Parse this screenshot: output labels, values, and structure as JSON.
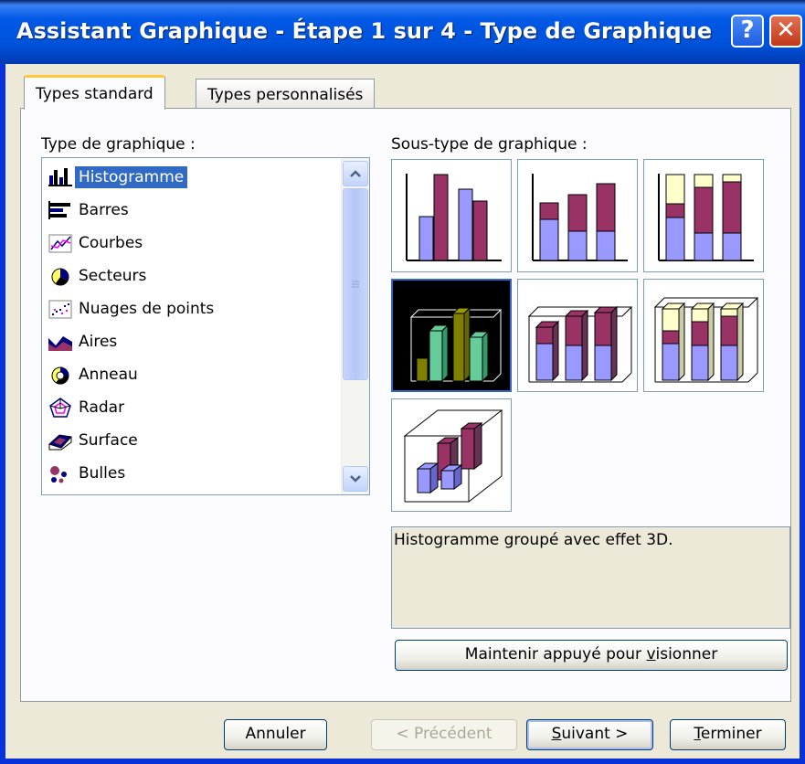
{
  "window": {
    "title": "Assistant Graphique - Étape 1 sur 4 - Type de Graphique",
    "help_label": "?",
    "close_label": "✕"
  },
  "tabs": [
    {
      "label": "Types standard",
      "active": true
    },
    {
      "label": "Types personnalisés",
      "active": false
    }
  ],
  "chart_type": {
    "label": "Type de graphique :",
    "items": [
      {
        "label": "Histogramme",
        "icon": "column-chart-icon",
        "selected": true
      },
      {
        "label": "Barres",
        "icon": "bar-chart-icon"
      },
      {
        "label": "Courbes",
        "icon": "line-chart-icon"
      },
      {
        "label": "Secteurs",
        "icon": "pie-chart-icon"
      },
      {
        "label": "Nuages de points",
        "icon": "scatter-chart-icon"
      },
      {
        "label": "Aires",
        "icon": "area-chart-icon"
      },
      {
        "label": "Anneau",
        "icon": "doughnut-chart-icon"
      },
      {
        "label": "Radar",
        "icon": "radar-chart-icon"
      },
      {
        "label": "Surface",
        "icon": "surface-chart-icon"
      },
      {
        "label": "Bulles",
        "icon": "bubble-chart-icon"
      }
    ]
  },
  "subtype": {
    "label": "Sous-type de graphique :",
    "selected_index": 3,
    "description": "Histogramme groupé avec effet 3D."
  },
  "preview_button": "Maintenir appuyé pour visionner",
  "footer": {
    "cancel": "Annuler",
    "back": "< Précédent",
    "next": "Suivant >",
    "finish": "Terminer"
  },
  "colors": {
    "series1": "#9999ff",
    "series2": "#993366",
    "series3": "#ffffcc",
    "selected_bar1": "#66cc99",
    "selected_bar2": "#808000",
    "selection": "#316ac5"
  }
}
